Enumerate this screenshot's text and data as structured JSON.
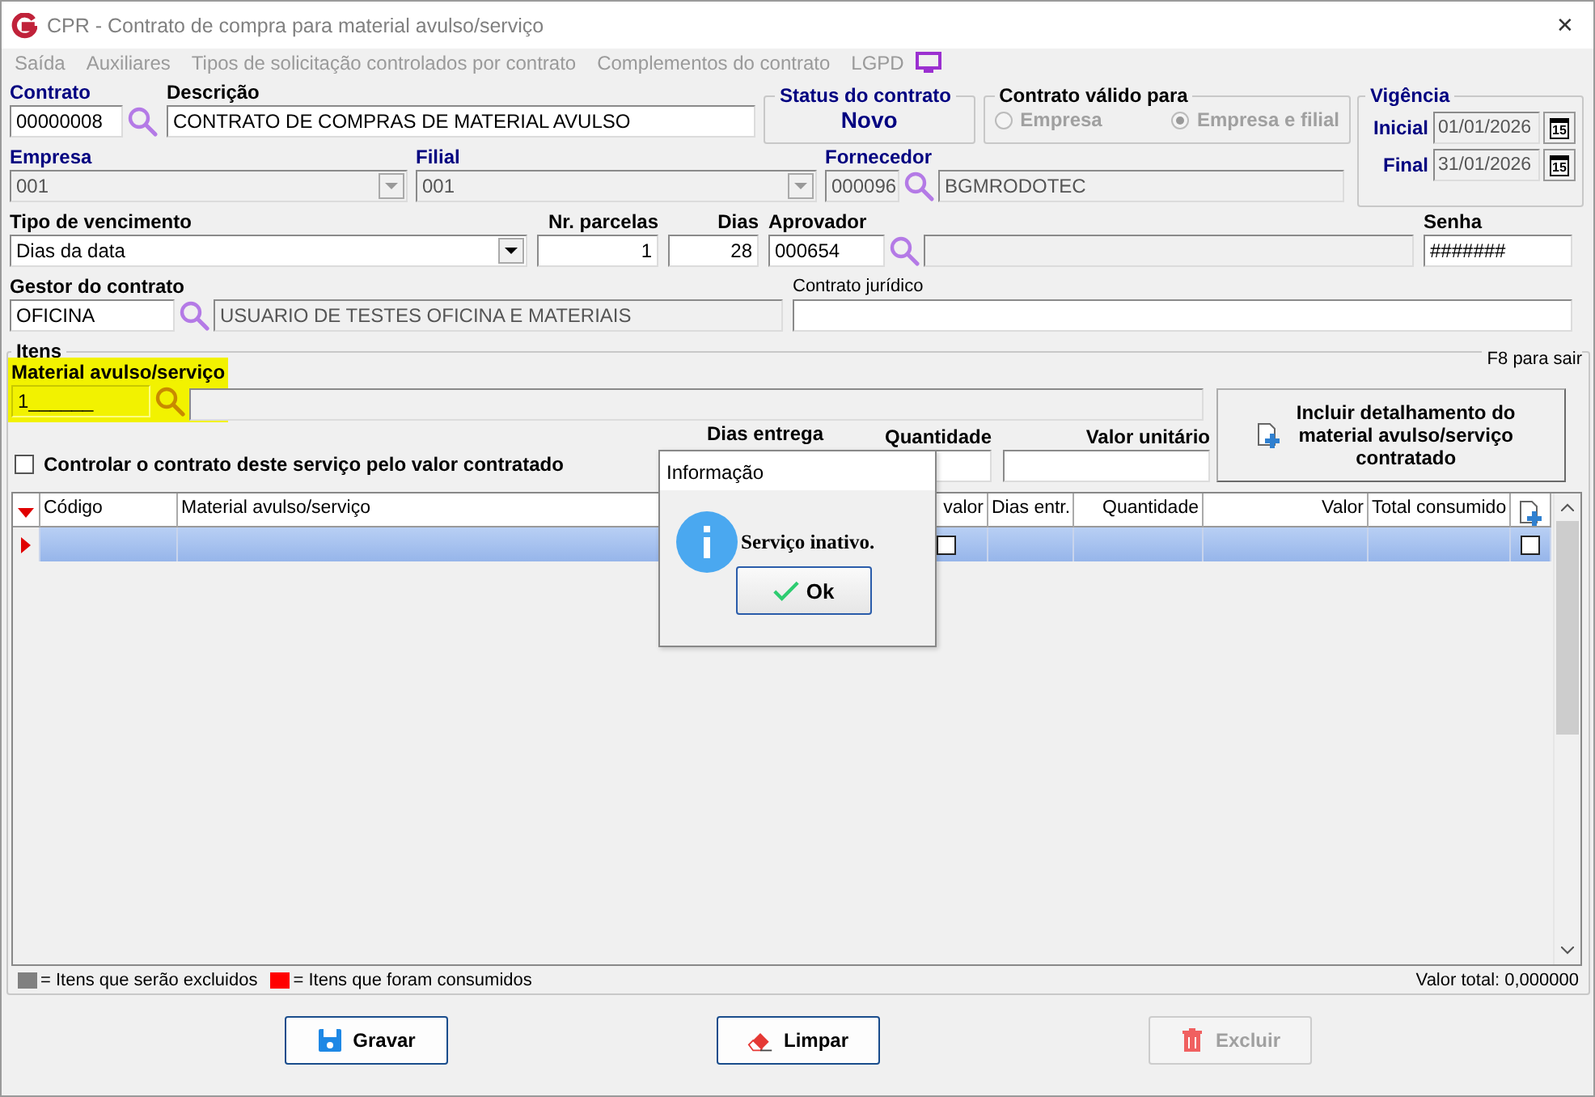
{
  "window": {
    "title": "CPR - Contrato de compra para material avulso/serviço",
    "close": "✕"
  },
  "menu": [
    {
      "label": "Saída",
      "disabled": true
    },
    {
      "label": "Auxiliares",
      "disabled": true
    },
    {
      "label": "Tipos de solicitação controlados por contrato",
      "disabled": true
    },
    {
      "label": "Complementos do contrato",
      "disabled": true
    },
    {
      "label": "LGPD",
      "disabled": true
    }
  ],
  "contrato": {
    "label": "Contrato",
    "required": true,
    "value": "00000008"
  },
  "descricao": {
    "label": "Descrição",
    "required": false,
    "value": "CONTRATO DE COMPRAS DE MATERIAL AVULSO"
  },
  "status": {
    "label": "Status do contrato",
    "value": "Novo"
  },
  "valido_para": {
    "label": "Contrato válido para",
    "disabled": true,
    "options": [
      {
        "label": "Empresa",
        "selected": false
      },
      {
        "label": "Empresa e filial",
        "selected": true
      }
    ]
  },
  "vigencia": {
    "label": "Vigência",
    "dates": [
      {
        "label": "Inicial",
        "value": "01/01/2026",
        "day": "15"
      },
      {
        "label": "Final",
        "value": "31/01/2026",
        "day": "15"
      }
    ]
  },
  "empresa": {
    "label": "Empresa",
    "required": true,
    "value": "001",
    "disabled": true
  },
  "filial": {
    "label": "Filial",
    "required": true,
    "value": "001",
    "disabled": true
  },
  "fornecedor": {
    "label": "Fornecedor",
    "required": true,
    "code": "000096",
    "name": "BGMRODOTEC"
  },
  "tipo_vencimento": {
    "label": "Tipo de vencimento",
    "required": false,
    "value": "Dias da data"
  },
  "nr_parcelas": {
    "label": "Nr. parcelas",
    "value": "1"
  },
  "dias": {
    "label": "Dias",
    "value": "28"
  },
  "aprovador": {
    "label": "Aprovador",
    "code": "000654"
  },
  "senha": {
    "label": "Senha",
    "value": "#######"
  },
  "gestor": {
    "label": "Gestor do contrato",
    "code": "OFICINA",
    "name": "USUARIO DE TESTES OFICINA E MATERIAIS"
  },
  "contrato_juridico": {
    "label": "Contrato jurídico"
  },
  "itens": {
    "title": "Itens",
    "hint": "F8 para sair",
    "material": {
      "label": "Material avulso/serviço",
      "value": "1______",
      "highlighted": true
    },
    "controlar": {
      "label": "Controlar o contrato deste serviço pelo valor contratado",
      "checked": false
    },
    "dias_entrega": {
      "label": "Dias entrega"
    },
    "quantidade": {
      "label": "Quantidade"
    },
    "valor_unitario": {
      "label": "Valor unitário"
    },
    "incluir_button": "Incluir detalhamento do material avulso/serviço contratado"
  },
  "table": {
    "columns": [
      {
        "label": "Código"
      },
      {
        "label": "Material avulso/serviço"
      },
      {
        "label": "valor"
      },
      {
        "label": "Dias entr."
      },
      {
        "label": "Quantidade"
      },
      {
        "label": "Valor"
      },
      {
        "label": "Total consumido"
      }
    ],
    "rows": [
      {
        "selected": true,
        "controla_valor": false,
        "marcado": false
      }
    ]
  },
  "legend": [
    {
      "label": "= Itens que serão excluidos",
      "color": "#808080"
    },
    {
      "label": "= Itens que foram consumidos",
      "color": "#ff0000"
    }
  ],
  "total": "Valor total: 0,000000",
  "buttons": [
    {
      "label": "Gravar",
      "kind": "save",
      "disabled": false
    },
    {
      "label": "Limpar",
      "kind": "clear",
      "disabled": false
    },
    {
      "label": "Excluir",
      "kind": "delete",
      "disabled": true
    }
  ],
  "dialog": {
    "title": "Informação",
    "message": "Serviço inativo.",
    "button": "Ok"
  }
}
